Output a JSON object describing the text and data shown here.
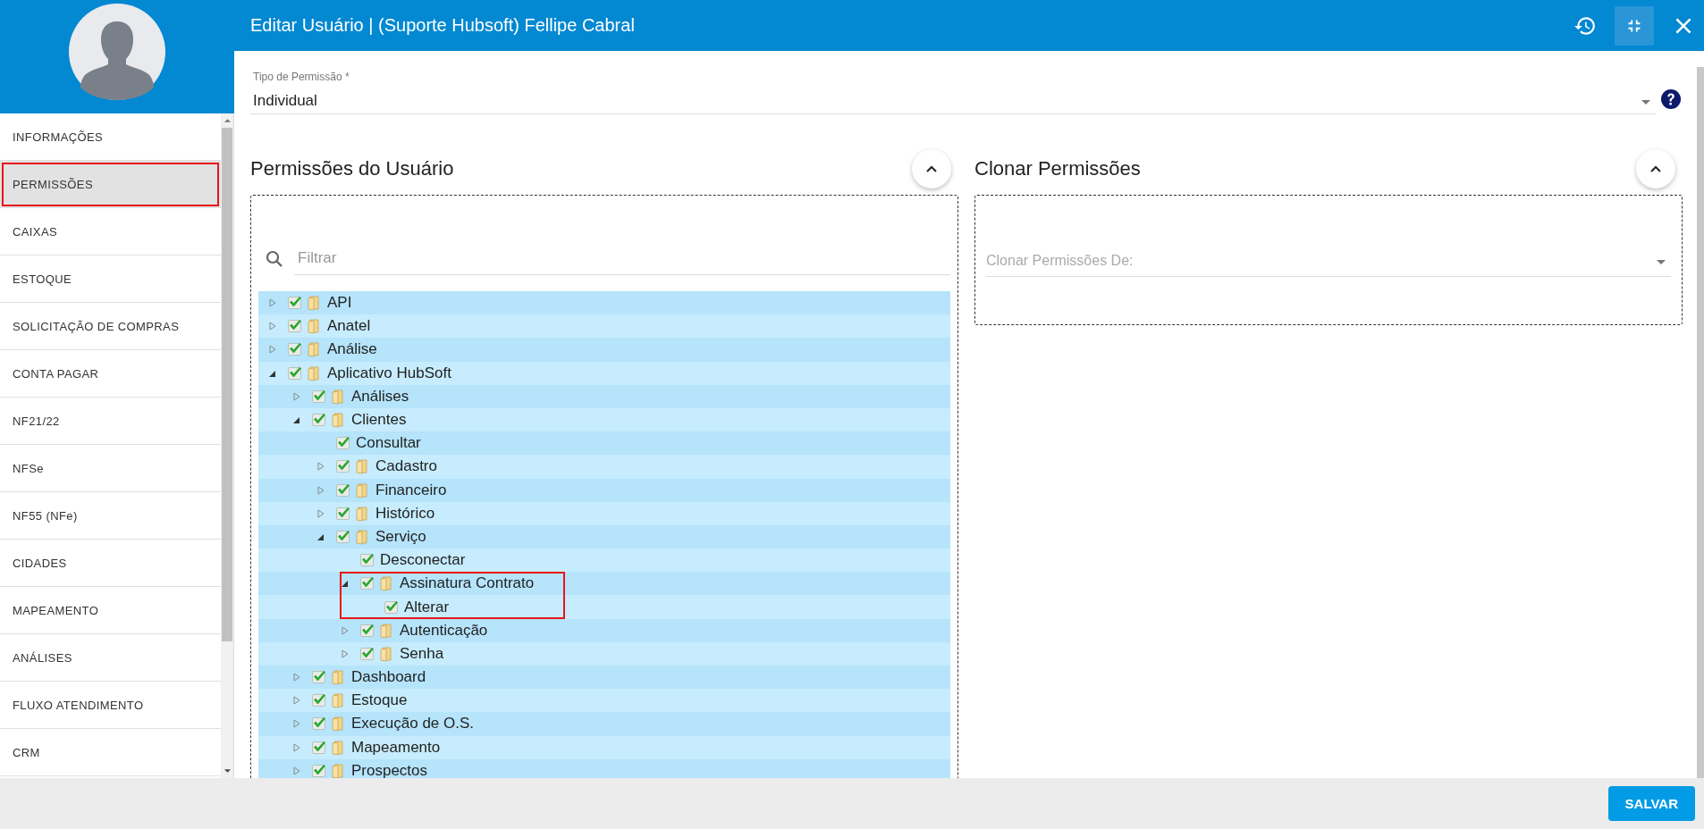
{
  "header": {
    "title": "Editar Usuário | (Suporte Hubsoft) Fellipe Cabral"
  },
  "sidebar": {
    "items": [
      {
        "label": "INFORMAÇÕES",
        "selected": false,
        "highlighted": false
      },
      {
        "label": "PERMISSÕES",
        "selected": true,
        "highlighted": true
      },
      {
        "label": "CAIXAS",
        "selected": false,
        "highlighted": false
      },
      {
        "label": "ESTOQUE",
        "selected": false,
        "highlighted": false
      },
      {
        "label": "SOLICITAÇÃO DE COMPRAS",
        "selected": false,
        "highlighted": false
      },
      {
        "label": "CONTA PAGAR",
        "selected": false,
        "highlighted": false
      },
      {
        "label": "NF21/22",
        "selected": false,
        "highlighted": false
      },
      {
        "label": "NFSe",
        "selected": false,
        "highlighted": false
      },
      {
        "label": "NF55 (NFe)",
        "selected": false,
        "highlighted": false
      },
      {
        "label": "CIDADES",
        "selected": false,
        "highlighted": false
      },
      {
        "label": "MAPEAMENTO",
        "selected": false,
        "highlighted": false
      },
      {
        "label": "ANÁLISES",
        "selected": false,
        "highlighted": false
      },
      {
        "label": "FLUXO ATENDIMENTO",
        "selected": false,
        "highlighted": false
      },
      {
        "label": "CRM",
        "selected": false,
        "highlighted": false
      }
    ]
  },
  "permission_type": {
    "label": "Tipo de Permissão *",
    "value": "Individual"
  },
  "user_permissions": {
    "title": "Permissões do Usuário",
    "expanded": true,
    "filter": {
      "placeholder": "Filtrar"
    },
    "tree": [
      {
        "label": "API",
        "kind": "folder",
        "checked": true,
        "expanded": false
      },
      {
        "label": "Anatel",
        "kind": "folder",
        "checked": true,
        "expanded": false
      },
      {
        "label": "Análise",
        "kind": "folder",
        "checked": true,
        "expanded": false
      },
      {
        "label": "Aplicativo HubSoft",
        "kind": "folder",
        "checked": true,
        "expanded": true,
        "children": [
          {
            "label": "Análises",
            "kind": "folder",
            "checked": true,
            "expanded": false
          },
          {
            "label": "Clientes",
            "kind": "folder",
            "checked": true,
            "expanded": true,
            "children": [
              {
                "label": "Consultar",
                "kind": "leaf",
                "checked": true
              },
              {
                "label": "Cadastro",
                "kind": "folder",
                "checked": true,
                "expanded": false
              },
              {
                "label": "Financeiro",
                "kind": "folder",
                "checked": true,
                "expanded": false
              },
              {
                "label": "Histórico",
                "kind": "folder",
                "checked": true,
                "expanded": false
              },
              {
                "label": "Serviço",
                "kind": "folder",
                "checked": true,
                "expanded": true,
                "children": [
                  {
                    "label": "Desconectar",
                    "kind": "leaf",
                    "checked": true
                  },
                  {
                    "label": "Assinatura Contrato",
                    "kind": "folder",
                    "checked": true,
                    "expanded": true,
                    "highlighted": true,
                    "children": [
                      {
                        "label": "Alterar",
                        "kind": "leaf",
                        "checked": true
                      }
                    ]
                  },
                  {
                    "label": "Autenticação",
                    "kind": "folder",
                    "checked": true,
                    "expanded": false
                  },
                  {
                    "label": "Senha",
                    "kind": "folder",
                    "checked": true,
                    "expanded": false
                  }
                ]
              }
            ]
          },
          {
            "label": "Dashboard",
            "kind": "folder",
            "checked": true,
            "expanded": false
          },
          {
            "label": "Estoque",
            "kind": "folder",
            "checked": true,
            "expanded": false
          },
          {
            "label": "Execução de O.S.",
            "kind": "folder",
            "checked": true,
            "expanded": false
          },
          {
            "label": "Mapeamento",
            "kind": "folder",
            "checked": true,
            "expanded": false
          },
          {
            "label": "Prospectos",
            "kind": "folder",
            "checked": true,
            "expanded": false
          }
        ]
      }
    ]
  },
  "clone_permissions": {
    "title": "Clonar Permissões",
    "expanded": true,
    "select": {
      "placeholder": "Clonar Permissões De:"
    }
  },
  "footer": {
    "save_button": "SALVAR"
  }
}
